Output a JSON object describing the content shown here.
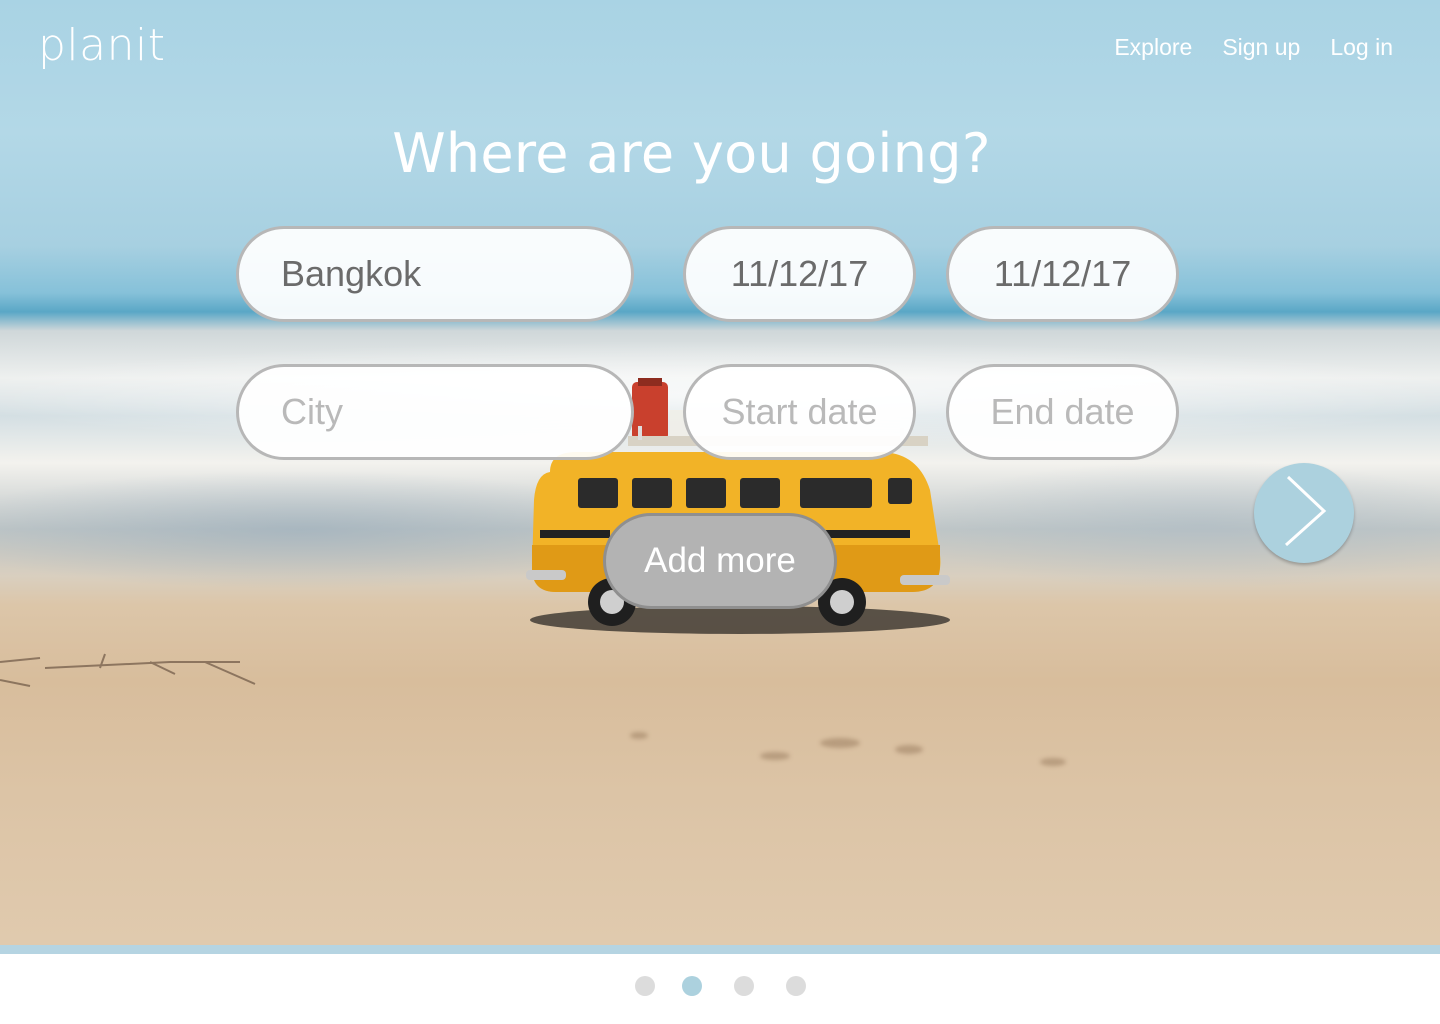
{
  "header": {
    "brand": "planit",
    "nav": [
      {
        "label": "Explore"
      },
      {
        "label": "Sign up"
      },
      {
        "label": "Log in"
      }
    ]
  },
  "main": {
    "headline": "Where are you going?",
    "trips": [
      {
        "city": {
          "value": "Bangkok",
          "placeholder": "City"
        },
        "start_date": {
          "value": "11/12/17",
          "placeholder": "Start date"
        },
        "end_date": {
          "value": "11/12/17",
          "placeholder": "End date"
        }
      },
      {
        "city": {
          "value": "",
          "placeholder": "City"
        },
        "start_date": {
          "value": "",
          "placeholder": "Start date"
        },
        "end_date": {
          "value": "",
          "placeholder": "End date"
        }
      }
    ],
    "add_more_label": "Add more",
    "next_icon": "chevron-right-icon"
  },
  "pagination": {
    "total": 4,
    "active_index": 1
  },
  "colors": {
    "accent": "#acd1de",
    "field_border": "#b7b7b7",
    "add_more_bg": "#b3b3b3",
    "dot_inactive": "#dcdcdc",
    "text_muted": "#6b6b6b",
    "placeholder": "#b9b9b9"
  }
}
